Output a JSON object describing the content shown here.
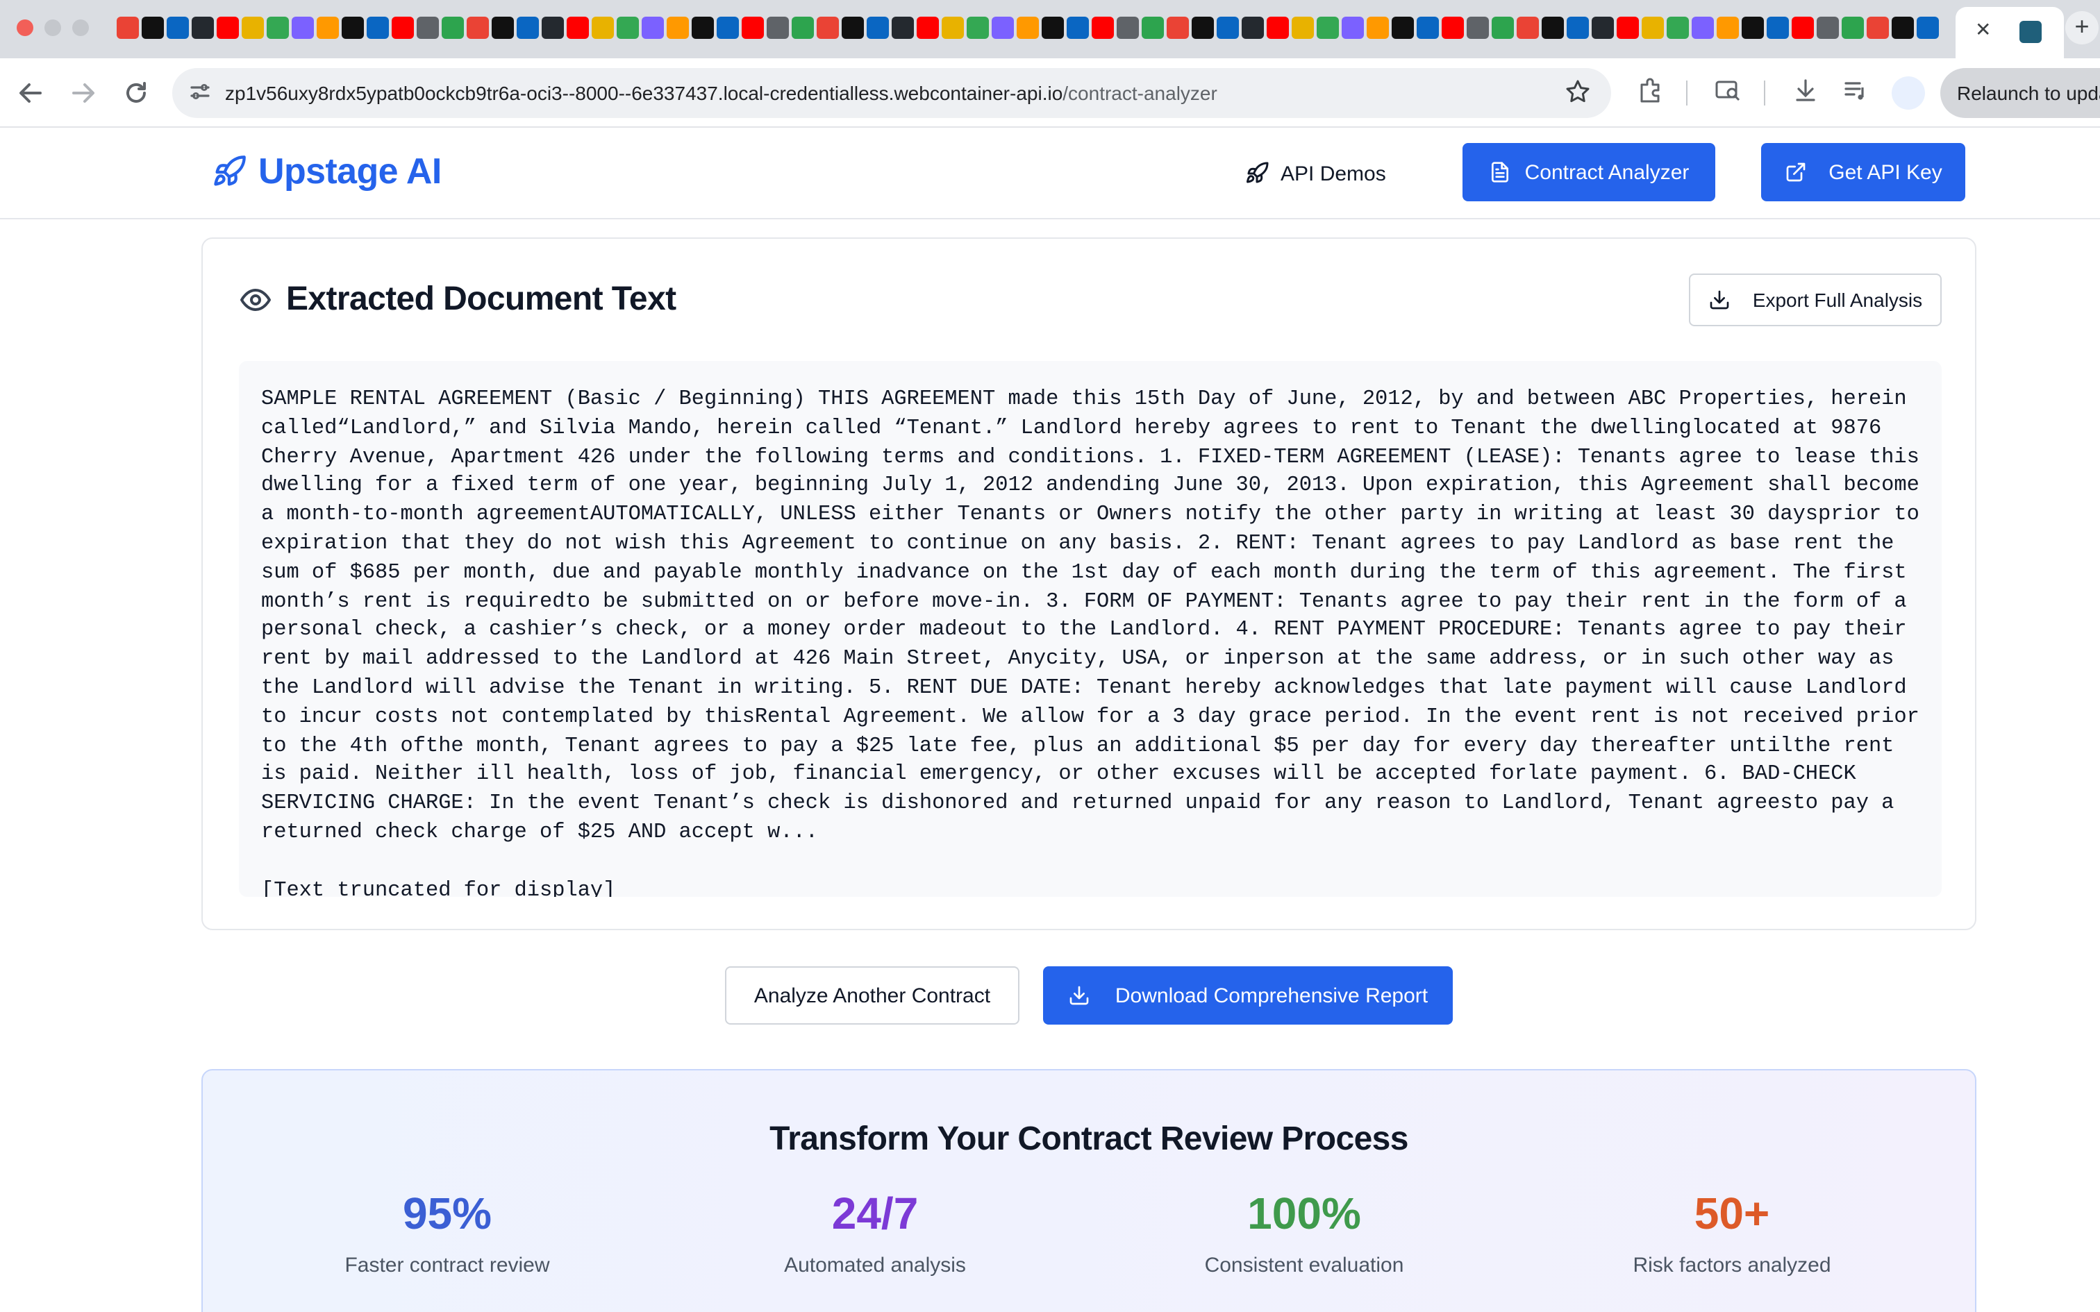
{
  "browser": {
    "url_host": "zp1v56uxy8rdx5ypatb0ockcb9tr6a-oci3--8000--6e337437.local-credentialless.webcontainer-api.io",
    "url_path": "/contract-analyzer",
    "relaunch_label": "Relaunch to update",
    "tab_close_glyph": "✕",
    "new_tab_glyph": "+"
  },
  "header": {
    "brand": "Upstage AI",
    "nav_api_demos": "API Demos",
    "btn_contract_analyzer": "Contract Analyzer",
    "btn_get_api_key": "Get API Key"
  },
  "extracted": {
    "title": "Extracted Document Text",
    "export_label": "Export Full Analysis",
    "body": "SAMPLE RENTAL AGREEMENT (Basic / Beginning) THIS AGREEMENT made this 15th Day of June, 2012, by and between ABC Properties, herein called“Landlord,” and Silvia Mando, herein called “Tenant.” Landlord hereby agrees to rent to Tenant the dwellinglocated at 9876 Cherry Avenue, Apartment 426 under the following terms and conditions. 1. FIXED-TERM AGREEMENT (LEASE): Tenants agree to lease this dwelling for a fixed term of one year, beginning July 1, 2012 andending June 30, 2013. Upon expiration, this Agreement shall become a month-to-month agreementAUTOMATICALLY, UNLESS either Tenants or Owners notify the other party in writing at least 30 daysprior to expiration that they do not wish this Agreement to continue on any basis. 2. RENT: Tenant agrees to pay Landlord as base rent the sum of $685 per month, due and payable monthly inadvance on the 1st day of each month during the term of this agreement. The first month’s rent is requiredto be submitted on or before move-in. 3. FORM OF PAYMENT: Tenants agree to pay their rent in the form of a personal check, a cashier’s check, or a money order madeout to the Landlord. 4. RENT PAYMENT PROCEDURE: Tenants agree to pay their rent by mail addressed to the Landlord at 426 Main Street, Anycity, USA, or inperson at the same address, or in such other way as the Landlord will advise the Tenant in writing. 5. RENT DUE DATE: Tenant hereby acknowledges that late payment will cause Landlord to incur costs not contemplated by thisRental Agreement. We allow for a 3 day grace period. In the event rent is not received prior to the 4th ofthe month, Tenant agrees to pay a $25 late fee, plus an additional $5 per day for every day thereafter untilthe rent is paid. Neither ill health, loss of job, financial emergency, or other excuses will be accepted forlate payment. 6. BAD-CHECK SERVICING CHARGE: In the event Tenant’s check is dishonored and returned unpaid for any reason to Landlord, Tenant agreesto pay a returned check charge of $25 AND accept w...\n\n[Text truncated for display]"
  },
  "actions": {
    "analyze_another": "Analyze Another Contract",
    "download_report": "Download Comprehensive Report"
  },
  "stats": {
    "title": "Transform Your Contract Review Process",
    "items": [
      {
        "value": "95%",
        "label": "Faster contract review",
        "color": "#3b5fd4"
      },
      {
        "value": "24/7",
        "label": "Automated analysis",
        "color": "#7c3ad6"
      },
      {
        "value": "100%",
        "label": "Consistent evaluation",
        "color": "#3f9a4c"
      },
      {
        "value": "50+",
        "label": "Risk factors analyzed",
        "color": "#dd5a28"
      }
    ]
  },
  "colors": {
    "accent": "#2563eb",
    "text": "#111827",
    "muted": "#4b5563"
  }
}
